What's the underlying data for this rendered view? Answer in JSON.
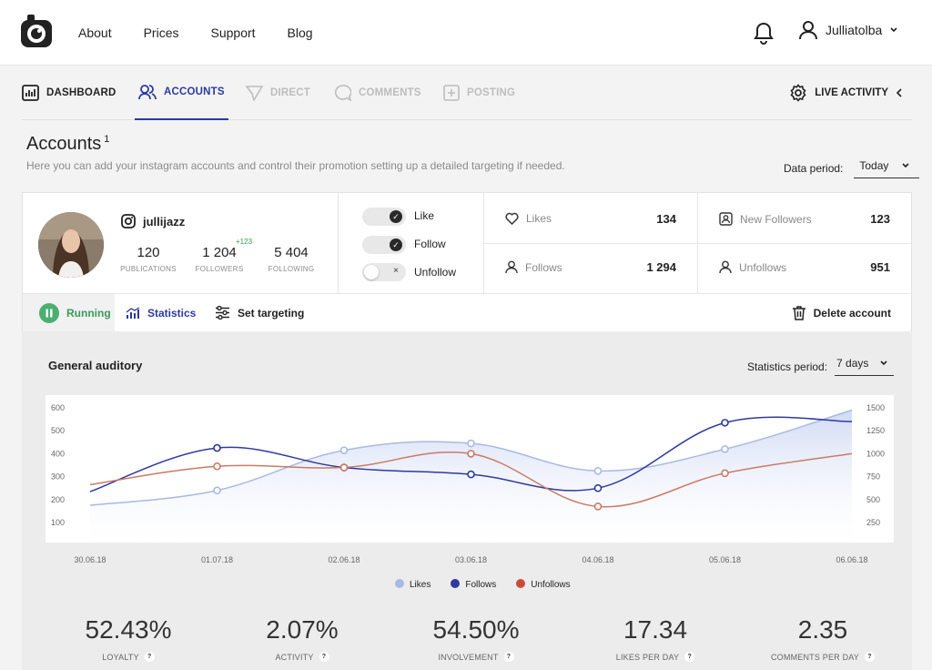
{
  "topnav": {
    "items": [
      "About",
      "Prices",
      "Support",
      "Blog"
    ],
    "username": "Julliatolba"
  },
  "tabs": [
    {
      "label": "DASHBOARD",
      "icon": "dashboard-icon",
      "state": "normal"
    },
    {
      "label": "ACCOUNTS",
      "icon": "accounts-icon",
      "state": "active"
    },
    {
      "label": "DIRECT",
      "icon": "direct-icon",
      "state": "disabled"
    },
    {
      "label": "COMMENTS",
      "icon": "comments-icon",
      "state": "disabled"
    },
    {
      "label": "POSTING",
      "icon": "posting-icon",
      "state": "disabled"
    }
  ],
  "live_activity": "LIVE ACTIVITY",
  "page": {
    "title": "Accounts",
    "count": "1",
    "subtitle": "Here you can add your instagram accounts and control their promotion setting up a detailed targeting if needed.",
    "period_label": "Data period:",
    "period_value": "Today"
  },
  "account": {
    "handle": "jullijazz",
    "publications": "120",
    "publications_label": "PUBLICATIONS",
    "followers": "1 204",
    "followers_label": "FOLLOWERS",
    "followers_delta": "+123",
    "following": "5 404",
    "following_label": "FOLLOWING",
    "toggles": [
      {
        "label": "Like",
        "on": true
      },
      {
        "label": "Follow",
        "on": true
      },
      {
        "label": "Unfollow",
        "on": false
      }
    ],
    "metrics": {
      "likes_label": "Likes",
      "likes": "134",
      "new_followers_label": "New Followers",
      "new_followers": "123",
      "follows_label": "Follows",
      "follows": "1 294",
      "unfollows_label": "Unfollows",
      "unfollows": "951"
    },
    "subtabs": {
      "running": "Running",
      "statistics": "Statistics",
      "targeting": "Set targeting",
      "delete": "Delete account"
    }
  },
  "chart": {
    "title": "General auditory",
    "period_label": "Statistics period:",
    "period_value": "7 days"
  },
  "chart_data": {
    "type": "line",
    "title": "General auditory",
    "x": [
      "30.06.18",
      "01.07.18",
      "02.06.18",
      "03.06.18",
      "04.06.18",
      "05.06.18",
      "06.06.18"
    ],
    "y_left_ticks": [
      "600",
      "500",
      "400",
      "300",
      "200",
      "100"
    ],
    "y_right_ticks": [
      "1500",
      "1250",
      "1000",
      "750",
      "500",
      "250"
    ],
    "y_left_range": [
      100,
      600
    ],
    "y_right_range": [
      250,
      1500
    ],
    "series": [
      {
        "name": "Likes",
        "color": "#a9b9e6",
        "axis": "left",
        "values": [
          175,
          240,
          415,
          445,
          325,
          420,
          590
        ]
      },
      {
        "name": "Follows",
        "color": "#2f3a9f",
        "axis": "left",
        "values": [
          235,
          425,
          340,
          310,
          250,
          535,
          540
        ]
      },
      {
        "name": "Unfollows",
        "color": "#c97b66",
        "axis": "left",
        "values": [
          265,
          345,
          340,
          400,
          170,
          315,
          400
        ]
      }
    ],
    "legend_position": "bottom-center"
  },
  "kpis": [
    {
      "value": "52.43%",
      "label": "LOYALTY"
    },
    {
      "value": "2.07%",
      "label": "ACTIVITY"
    },
    {
      "value": "54.50%",
      "label": "INVOLVEMENT"
    },
    {
      "value": "17.34",
      "label": "LIKES PER DAY"
    },
    {
      "value": "2.35",
      "label": "COMMENTS PER DAY"
    }
  ],
  "help_glyph": "?",
  "toggle_check": "✓",
  "toggle_x": "×"
}
